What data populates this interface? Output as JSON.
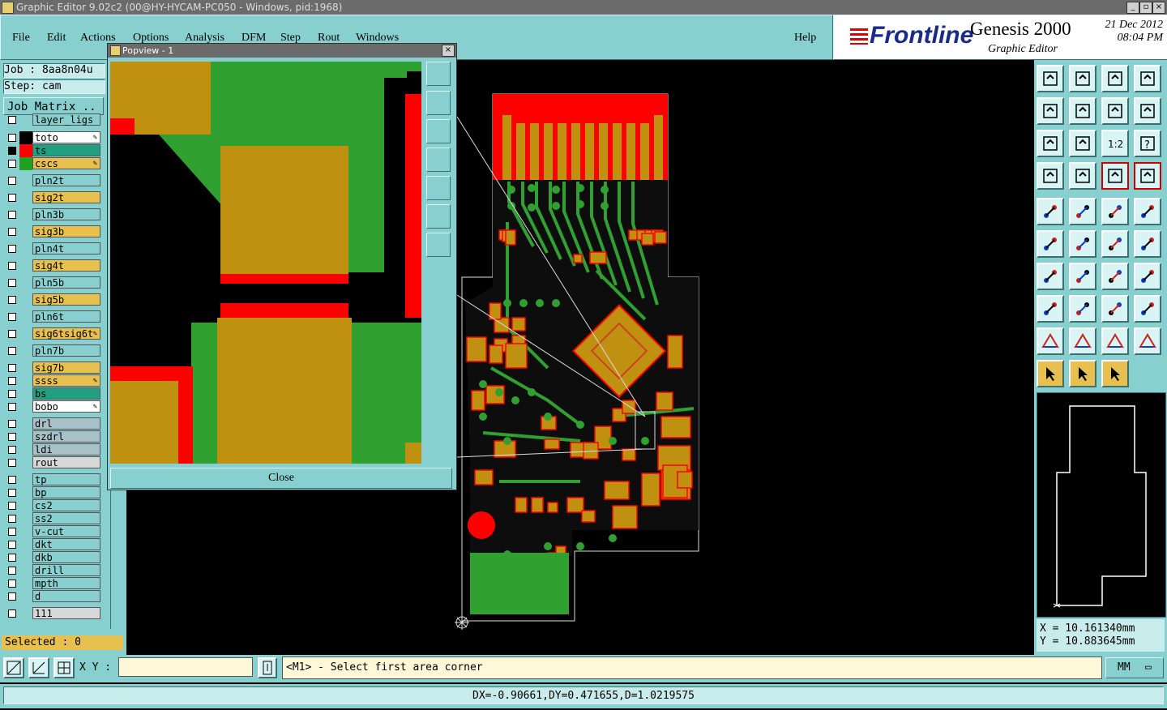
{
  "window": {
    "title": "Graphic Editor 9.02c2 (00@HY-HYCAM-PC050 - Windows, pid:1968)"
  },
  "menu": {
    "items": [
      "File",
      "Edit",
      "Actions",
      "Options",
      "Analysis",
      "DFM",
      "Step",
      "Rout",
      "Windows"
    ],
    "help": "Help"
  },
  "brand": {
    "logo": "Frontline",
    "product": "Genesis 2000",
    "subtitle": "Graphic Editor",
    "date": "21 Dec 2012",
    "time": "08:04 PM"
  },
  "job": {
    "job_label": "Job : 8aa8n04u",
    "step_label": "Step: cam",
    "matrix_button": "Job Matrix .."
  },
  "layers": [
    {
      "name": "layer_ligs",
      "color": "#88d0d0"
    },
    {
      "name": "to",
      "color": "#ffffff",
      "swatch": "#000000",
      "edit": true
    },
    {
      "name": "ts",
      "color": "#20a080",
      "swatch": "#ff0000",
      "active": true
    },
    {
      "name": "cs",
      "color": "#e8c050",
      "swatch": "#20a020",
      "edit": true
    },
    {
      "name": "pln2t",
      "color": "#88d0d0"
    },
    {
      "name": "sig2t",
      "color": "#e8c050"
    },
    {
      "name": "pln3b",
      "color": "#88d0d0"
    },
    {
      "name": "sig3b",
      "color": "#e8c050"
    },
    {
      "name": "pln4t",
      "color": "#88d0d0"
    },
    {
      "name": "sig4t",
      "color": "#e8c050"
    },
    {
      "name": "pln5b",
      "color": "#88d0d0"
    },
    {
      "name": "sig5b",
      "color": "#e8c050"
    },
    {
      "name": "pln6t",
      "color": "#88d0d0"
    },
    {
      "name": "sig6t",
      "color": "#e8c050",
      "edit": true
    },
    {
      "name": "pln7b",
      "color": "#88d0d0"
    },
    {
      "name": "sig7b",
      "color": "#e8c050"
    },
    {
      "name": "ss",
      "color": "#e8c050",
      "edit": true
    },
    {
      "name": "bs",
      "color": "#20a080"
    },
    {
      "name": "bo",
      "color": "#ffffff",
      "edit": true
    },
    {
      "name": "drl",
      "color": "#a8c0c8"
    },
    {
      "name": "szdrl",
      "color": "#a8c0c8"
    },
    {
      "name": "ldi",
      "color": "#a8c0c8"
    },
    {
      "name": "rout",
      "color": "#d8d8d8"
    },
    {
      "name": "tp",
      "color": "#88d0d0"
    },
    {
      "name": "bp",
      "color": "#88d0d0"
    },
    {
      "name": "cs2",
      "color": "#88d0d0"
    },
    {
      "name": "ss2",
      "color": "#88d0d0"
    },
    {
      "name": "v-cut",
      "color": "#88d0d0"
    },
    {
      "name": "dkt",
      "color": "#88d0d0"
    },
    {
      "name": "dkb",
      "color": "#88d0d0"
    },
    {
      "name": "drill",
      "color": "#88d0d0"
    },
    {
      "name": "mpth",
      "color": "#88d0d0"
    },
    {
      "name": "d",
      "color": "#88d0d0"
    },
    {
      "name": "111",
      "color": "#d8d8d8"
    }
  ],
  "selected": "Selected : 0",
  "popview": {
    "title": "Popview - 1",
    "close_label": "Close"
  },
  "coords": {
    "x": "X = 10.161340mm",
    "y": "Y = 10.883645mm"
  },
  "input": {
    "xy_label": "X Y :",
    "xy_value": ""
  },
  "prompt": "<M1> - Select first area corner",
  "units": "MM",
  "status": "DX=-0.90661,DY=0.471655,D=1.0219575",
  "colors": {
    "panel": "#88d0d0",
    "copper": "#c09010",
    "mask_green": "#30a030",
    "mask_red": "#ff0000"
  },
  "icons": {
    "toolbar": [
      "zoom-up-icon",
      "zoom-down-icon",
      "home-icon",
      "window-icon",
      "pan-left-icon",
      "pan-right-icon",
      "pan-back-icon",
      "pan-reverse-icon",
      "fit-icon",
      "center-icon",
      "ratio-1-2-icon",
      "help-icon",
      "tools-icon",
      "snap-icon",
      "layer-display-icon",
      "layer-display-red-icon",
      "measure-icon",
      "cross-icon",
      "ruler-icon",
      "circle-icon",
      "connect-icon",
      "delete-icon",
      "move-icon",
      "copy-icon",
      "angle-icon",
      "line-icon",
      "arc-icon",
      "text-icon",
      "pad-icon",
      "minus-icon",
      "resize-icon",
      "group-icon",
      "triangle-icon",
      "poly-icon",
      "arrow-icon",
      "arrow-select-icon",
      "select-icon",
      "cursor-icon",
      "tree-icon"
    ]
  }
}
